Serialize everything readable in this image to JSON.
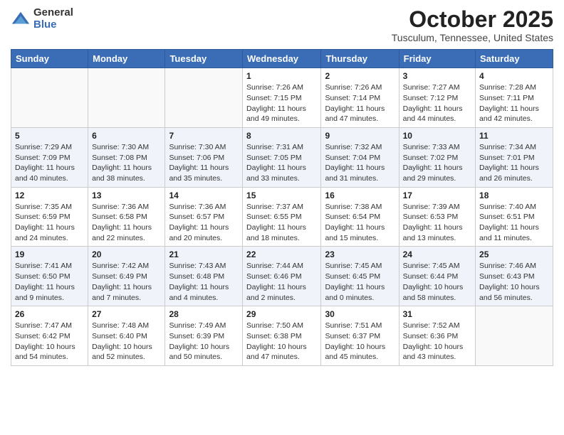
{
  "logo": {
    "general": "General",
    "blue": "Blue"
  },
  "header": {
    "title": "October 2025",
    "subtitle": "Tusculum, Tennessee, United States"
  },
  "weekdays": [
    "Sunday",
    "Monday",
    "Tuesday",
    "Wednesday",
    "Thursday",
    "Friday",
    "Saturday"
  ],
  "weeks": [
    [
      {
        "day": "",
        "info": ""
      },
      {
        "day": "",
        "info": ""
      },
      {
        "day": "",
        "info": ""
      },
      {
        "day": "1",
        "info": "Sunrise: 7:26 AM\nSunset: 7:15 PM\nDaylight: 11 hours and 49 minutes."
      },
      {
        "day": "2",
        "info": "Sunrise: 7:26 AM\nSunset: 7:14 PM\nDaylight: 11 hours and 47 minutes."
      },
      {
        "day": "3",
        "info": "Sunrise: 7:27 AM\nSunset: 7:12 PM\nDaylight: 11 hours and 44 minutes."
      },
      {
        "day": "4",
        "info": "Sunrise: 7:28 AM\nSunset: 7:11 PM\nDaylight: 11 hours and 42 minutes."
      }
    ],
    [
      {
        "day": "5",
        "info": "Sunrise: 7:29 AM\nSunset: 7:09 PM\nDaylight: 11 hours and 40 minutes."
      },
      {
        "day": "6",
        "info": "Sunrise: 7:30 AM\nSunset: 7:08 PM\nDaylight: 11 hours and 38 minutes."
      },
      {
        "day": "7",
        "info": "Sunrise: 7:30 AM\nSunset: 7:06 PM\nDaylight: 11 hours and 35 minutes."
      },
      {
        "day": "8",
        "info": "Sunrise: 7:31 AM\nSunset: 7:05 PM\nDaylight: 11 hours and 33 minutes."
      },
      {
        "day": "9",
        "info": "Sunrise: 7:32 AM\nSunset: 7:04 PM\nDaylight: 11 hours and 31 minutes."
      },
      {
        "day": "10",
        "info": "Sunrise: 7:33 AM\nSunset: 7:02 PM\nDaylight: 11 hours and 29 minutes."
      },
      {
        "day": "11",
        "info": "Sunrise: 7:34 AM\nSunset: 7:01 PM\nDaylight: 11 hours and 26 minutes."
      }
    ],
    [
      {
        "day": "12",
        "info": "Sunrise: 7:35 AM\nSunset: 6:59 PM\nDaylight: 11 hours and 24 minutes."
      },
      {
        "day": "13",
        "info": "Sunrise: 7:36 AM\nSunset: 6:58 PM\nDaylight: 11 hours and 22 minutes."
      },
      {
        "day": "14",
        "info": "Sunrise: 7:36 AM\nSunset: 6:57 PM\nDaylight: 11 hours and 20 minutes."
      },
      {
        "day": "15",
        "info": "Sunrise: 7:37 AM\nSunset: 6:55 PM\nDaylight: 11 hours and 18 minutes."
      },
      {
        "day": "16",
        "info": "Sunrise: 7:38 AM\nSunset: 6:54 PM\nDaylight: 11 hours and 15 minutes."
      },
      {
        "day": "17",
        "info": "Sunrise: 7:39 AM\nSunset: 6:53 PM\nDaylight: 11 hours and 13 minutes."
      },
      {
        "day": "18",
        "info": "Sunrise: 7:40 AM\nSunset: 6:51 PM\nDaylight: 11 hours and 11 minutes."
      }
    ],
    [
      {
        "day": "19",
        "info": "Sunrise: 7:41 AM\nSunset: 6:50 PM\nDaylight: 11 hours and 9 minutes."
      },
      {
        "day": "20",
        "info": "Sunrise: 7:42 AM\nSunset: 6:49 PM\nDaylight: 11 hours and 7 minutes."
      },
      {
        "day": "21",
        "info": "Sunrise: 7:43 AM\nSunset: 6:48 PM\nDaylight: 11 hours and 4 minutes."
      },
      {
        "day": "22",
        "info": "Sunrise: 7:44 AM\nSunset: 6:46 PM\nDaylight: 11 hours and 2 minutes."
      },
      {
        "day": "23",
        "info": "Sunrise: 7:45 AM\nSunset: 6:45 PM\nDaylight: 11 hours and 0 minutes."
      },
      {
        "day": "24",
        "info": "Sunrise: 7:45 AM\nSunset: 6:44 PM\nDaylight: 10 hours and 58 minutes."
      },
      {
        "day": "25",
        "info": "Sunrise: 7:46 AM\nSunset: 6:43 PM\nDaylight: 10 hours and 56 minutes."
      }
    ],
    [
      {
        "day": "26",
        "info": "Sunrise: 7:47 AM\nSunset: 6:42 PM\nDaylight: 10 hours and 54 minutes."
      },
      {
        "day": "27",
        "info": "Sunrise: 7:48 AM\nSunset: 6:40 PM\nDaylight: 10 hours and 52 minutes."
      },
      {
        "day": "28",
        "info": "Sunrise: 7:49 AM\nSunset: 6:39 PM\nDaylight: 10 hours and 50 minutes."
      },
      {
        "day": "29",
        "info": "Sunrise: 7:50 AM\nSunset: 6:38 PM\nDaylight: 10 hours and 47 minutes."
      },
      {
        "day": "30",
        "info": "Sunrise: 7:51 AM\nSunset: 6:37 PM\nDaylight: 10 hours and 45 minutes."
      },
      {
        "day": "31",
        "info": "Sunrise: 7:52 AM\nSunset: 6:36 PM\nDaylight: 10 hours and 43 minutes."
      },
      {
        "day": "",
        "info": ""
      }
    ]
  ]
}
